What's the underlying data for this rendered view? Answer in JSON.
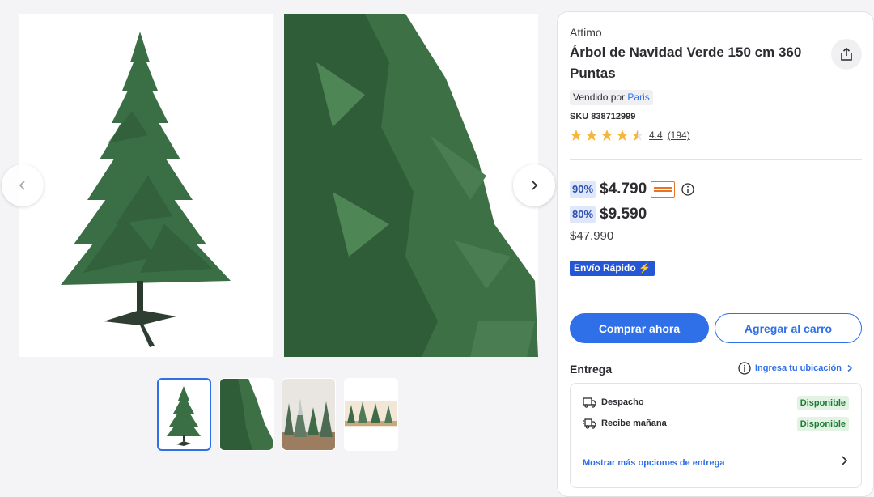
{
  "gallery": {
    "thumbnails": [
      "Árbol de Navidad vista completa",
      "Detalle de ramas",
      "Árboles con nieve",
      "Árboles decorativos"
    ]
  },
  "product": {
    "brand": "Attimo",
    "title": "Árbol de Navidad Verde 150 cm 360 Puntas",
    "seller_label": "Vendido por",
    "seller_name": "Paris",
    "sku": "SKU 838712999",
    "rating": "4.4",
    "rating_count": "(194)",
    "rating_stars": 4.4
  },
  "pricing": {
    "card_discount": "90%",
    "card_price": "$4.790",
    "internet_discount": "80%",
    "internet_price": "$9.590",
    "original_price": "$47.990",
    "fast_shipping": "Envío Rápido ⚡"
  },
  "actions": {
    "buy_now": "Comprar ahora",
    "add_to_cart": "Agregar al carro"
  },
  "delivery": {
    "title": "Entrega",
    "location_link": "Ingresa tu ubicación",
    "options": [
      {
        "label": "Despacho",
        "status": "Disponible",
        "icon": "truck-icon"
      },
      {
        "label": "Recibe mañana",
        "status": "Disponible",
        "icon": "fast-truck-icon"
      }
    ],
    "more_options": "Mostrar más opciones de entrega"
  },
  "colors": {
    "accent": "#2f6fe8",
    "badge_bg": "#dfe7fb",
    "available_bg": "#e2f3e4",
    "available_text": "#1d7a35",
    "tree_green": "#2e6b3c"
  }
}
